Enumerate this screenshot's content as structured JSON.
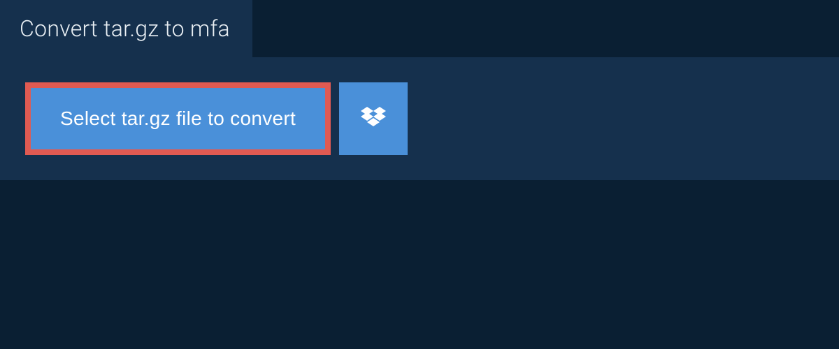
{
  "header": {
    "title": "Convert tar.gz to mfa"
  },
  "actions": {
    "select_file_label": "Select tar.gz file to convert"
  },
  "colors": {
    "background": "#0a1f33",
    "panel": "#15304d",
    "button": "#4a90d9",
    "highlight_border": "#e05a52",
    "text_light": "#e8eef3",
    "text_white": "#ffffff"
  }
}
